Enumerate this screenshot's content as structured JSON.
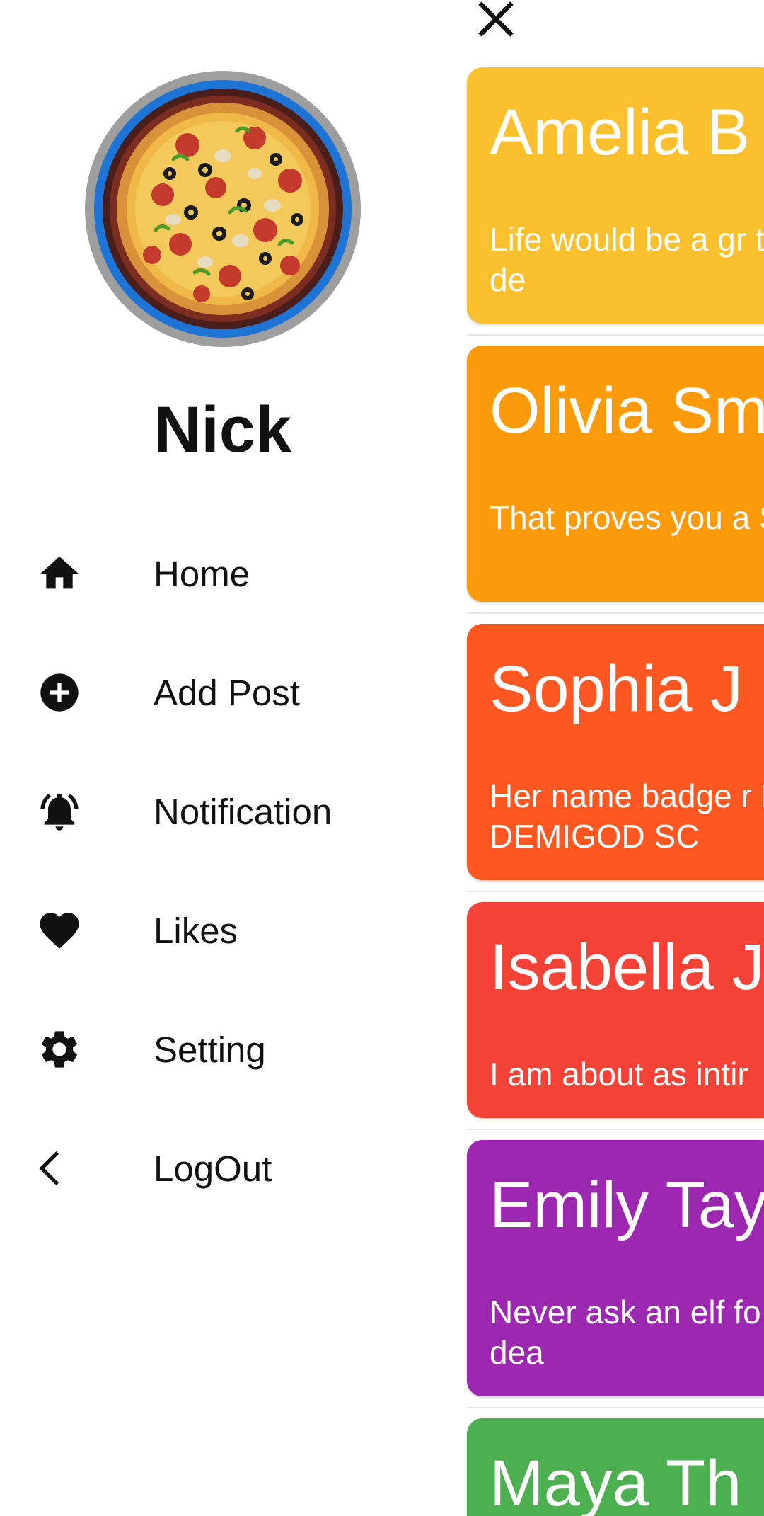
{
  "profile": {
    "name": "Nick",
    "avatar_icon": "pizza-avatar"
  },
  "menu": [
    {
      "label": "Home",
      "icon": "home-icon"
    },
    {
      "label": "Add Post",
      "icon": "add-circle-icon"
    },
    {
      "label": "Notification",
      "icon": "bell-icon"
    },
    {
      "label": "Likes",
      "icon": "heart-icon"
    },
    {
      "label": "Setting",
      "icon": "gear-icon"
    },
    {
      "label": "LogOut",
      "icon": "chevron-left-icon"
    }
  ],
  "content": {
    "close_icon": "close-icon",
    "posts": [
      {
        "title": "Amelia B",
        "body": "Life would be a gr things had the de",
        "color": "#FBC02D"
      },
      {
        "title": "Olivia Sm",
        "body": "That proves you a Scarecrow",
        "color": "#FB9A0A"
      },
      {
        "title": "Sophia J",
        "body": "Her name badge r DIE, DEMIGOD SC",
        "color": "#FF5722"
      },
      {
        "title": "Isabella J",
        "body": "I am about as intir",
        "color": "#F44336"
      },
      {
        "title": "Emily Tay",
        "body": "Never ask an elf fo your better off dea",
        "color": "#9C27B0"
      },
      {
        "title": "Maya Th",
        "body": "",
        "color": "#4CAF50"
      }
    ]
  },
  "colors": {
    "avatar_outer": "#9E9E9E",
    "avatar_ring": "#1E74D4"
  }
}
